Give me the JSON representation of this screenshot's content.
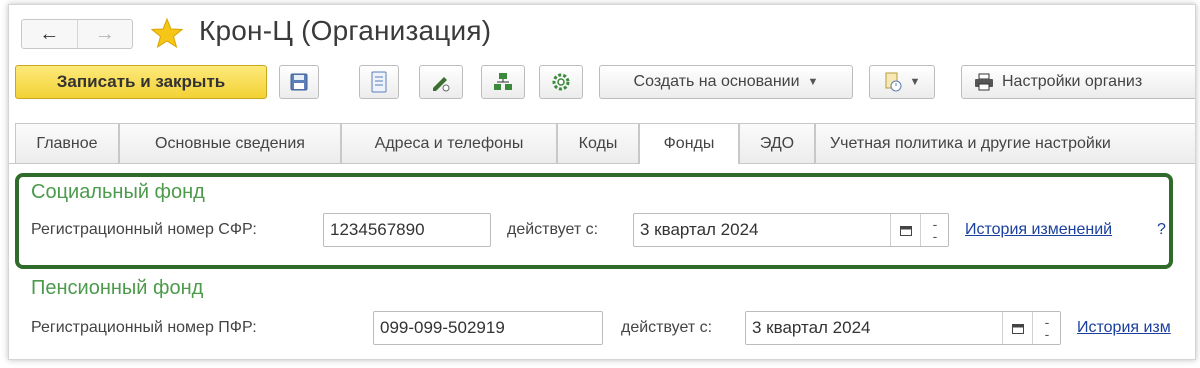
{
  "window": {
    "title": "Крон-Ц (Организация)",
    "back_icon": "←",
    "forward_icon": "→"
  },
  "toolbar": {
    "save_close_label": "Записать и закрыть",
    "create_based_label": "Создать на основании",
    "settings_label": "Настройки организ"
  },
  "tabs": [
    {
      "label": "Главное"
    },
    {
      "label": "Основные сведения"
    },
    {
      "label": "Адреса и телефоны"
    },
    {
      "label": "Коды"
    },
    {
      "label": "Фонды",
      "active": true
    },
    {
      "label": "ЭДО"
    },
    {
      "label": "Учетная политика и другие настройки"
    }
  ],
  "sfr": {
    "title": "Социальный фонд",
    "reg_label": "Регистрационный номер СФР:",
    "reg_value": "1234567890",
    "valid_from_label": "действует с:",
    "valid_from_value": "3 квартал 2024",
    "history_link": "История изменений",
    "help": "?"
  },
  "pfr": {
    "title": "Пенсионный фонд",
    "reg_label": "Регистрационный номер ПФР:",
    "reg_value": "099-099-502919",
    "valid_from_label": "действует с:",
    "valid_from_value": "3 квартал 2024",
    "history_link": "История изм"
  },
  "colors": {
    "highlight_border": "#2f6b2a",
    "section_title": "#4c9a4c",
    "primary_button": "#f3d235",
    "link": "#1a3f9e"
  }
}
